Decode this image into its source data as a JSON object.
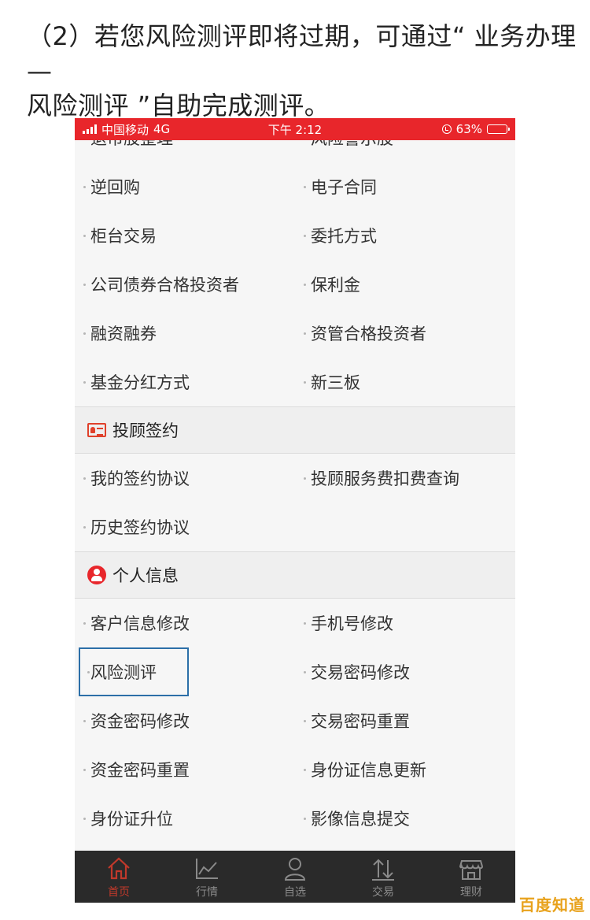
{
  "instruction": {
    "line1": "（2）若您风险测评即将过期，可通过“ 业务办理—",
    "line2": "风险测评 ”自助完成测评。"
  },
  "status_bar": {
    "carrier": "中国移动",
    "network": "4G",
    "time": "下午 2:12",
    "battery": "63%",
    "battery_level": 0.63
  },
  "top_partial": {
    "left": "退市股整理",
    "right": "风险警示股"
  },
  "items_main": [
    [
      "逆回购",
      "电子合同"
    ],
    [
      "柜台交易",
      "委托方式"
    ],
    [
      "公司债券合格投资者",
      "保利金"
    ],
    [
      "融资融券",
      "资管合格投资者"
    ],
    [
      "基金分红方式",
      "新三板"
    ]
  ],
  "section_advisor": {
    "title": "投顾签约",
    "icon": "id-card-icon",
    "items": [
      [
        "我的签约协议",
        "投顾服务费扣费查询"
      ],
      [
        "历史签约协议",
        ""
      ]
    ]
  },
  "section_personal": {
    "title": "个人信息",
    "icon": "person-icon",
    "items": [
      [
        "客户信息修改",
        "手机号修改"
      ],
      [
        "风险测评",
        "交易密码修改"
      ],
      [
        "资金密码修改",
        "交易密码重置"
      ],
      [
        "资金密码重置",
        "身份证信息更新"
      ],
      [
        "身份证升位",
        "影像信息提交"
      ]
    ]
  },
  "tabbar": [
    {
      "label": "首页",
      "icon": "home-icon",
      "active": true
    },
    {
      "label": "行情",
      "icon": "chart-icon",
      "active": false
    },
    {
      "label": "自选",
      "icon": "user-icon",
      "active": false
    },
    {
      "label": "交易",
      "icon": "transfer-icon",
      "active": false
    },
    {
      "label": "理财",
      "icon": "store-icon",
      "active": false
    }
  ],
  "colors": {
    "status_bar": "#e8262b",
    "tabbar_bg": "#2a2a2a",
    "active_tab": "#c0392b",
    "highlight_box": "#2c6fa8"
  },
  "watermark": "百度知道"
}
